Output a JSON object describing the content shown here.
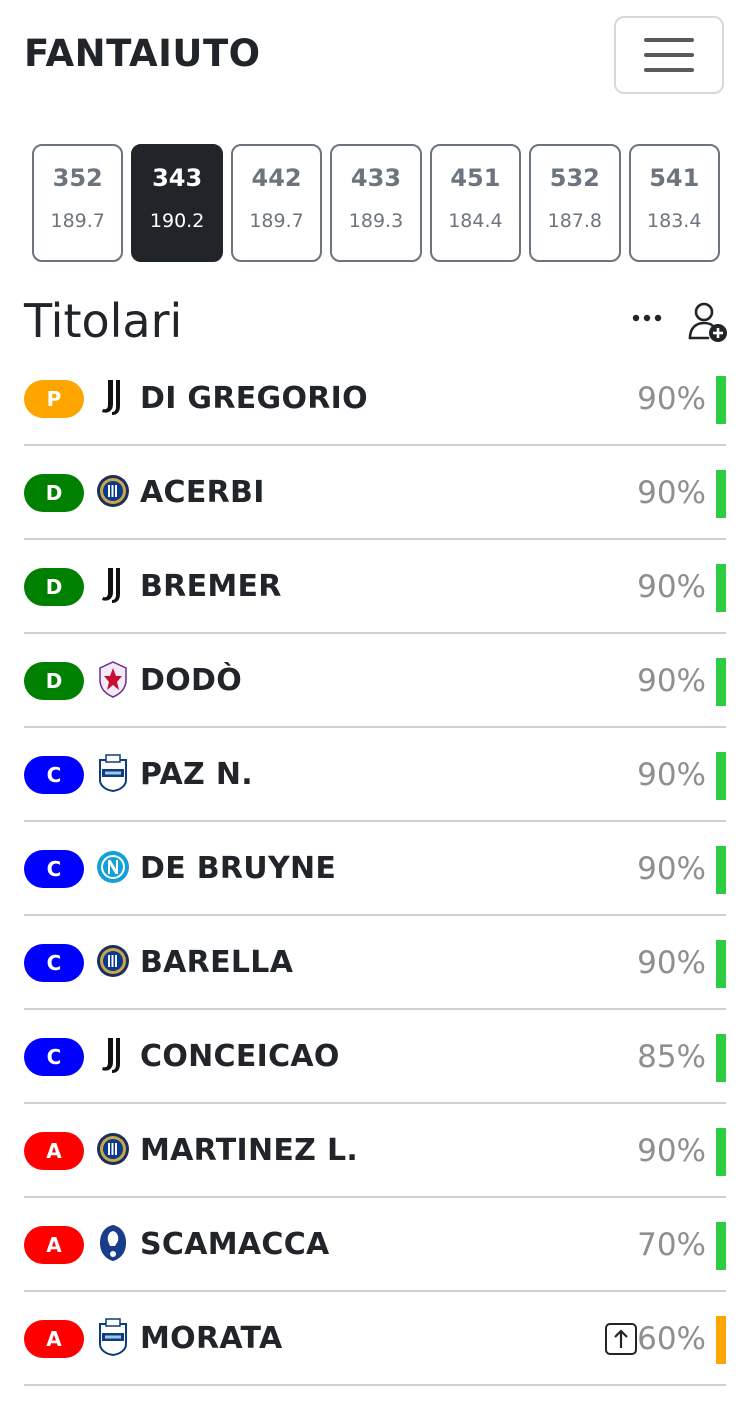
{
  "app": {
    "title": "FANTAIUTO"
  },
  "formations": [
    {
      "name": "352",
      "score": "189.7",
      "active": false
    },
    {
      "name": "343",
      "score": "190.2",
      "active": true
    },
    {
      "name": "442",
      "score": "189.7",
      "active": false
    },
    {
      "name": "433",
      "score": "189.3",
      "active": false
    },
    {
      "name": "451",
      "score": "184.4",
      "active": false
    },
    {
      "name": "532",
      "score": "187.8",
      "active": false
    },
    {
      "name": "541",
      "score": "183.4",
      "active": false
    }
  ],
  "section": {
    "title": "Titolari"
  },
  "colors": {
    "P": "#ffa500",
    "D": "#008000",
    "C": "#0000ff",
    "A": "#ff0000",
    "status_green": "#2ecc40",
    "status_orange": "#ffa500"
  },
  "players": [
    {
      "role": "P",
      "team_icon": "juventus-logo-icon",
      "name": "DI GREGORIO",
      "pct": "90%",
      "status": "status_green"
    },
    {
      "role": "D",
      "team_icon": "inter-logo-icon",
      "name": "ACERBI",
      "pct": "90%",
      "status": "status_green"
    },
    {
      "role": "D",
      "team_icon": "juventus-logo-icon",
      "name": "BREMER",
      "pct": "90%",
      "status": "status_green"
    },
    {
      "role": "D",
      "team_icon": "fiorentina-logo-icon",
      "name": "DODÒ",
      "pct": "90%",
      "status": "status_green"
    },
    {
      "role": "C",
      "team_icon": "como-logo-icon",
      "name": "PAZ N.",
      "pct": "90%",
      "status": "status_green"
    },
    {
      "role": "C",
      "team_icon": "napoli-logo-icon",
      "name": "DE BRUYNE",
      "pct": "90%",
      "status": "status_green"
    },
    {
      "role": "C",
      "team_icon": "inter-logo-icon",
      "name": "BARELLA",
      "pct": "90%",
      "status": "status_green"
    },
    {
      "role": "C",
      "team_icon": "juventus-logo-icon",
      "name": "CONCEICAO",
      "pct": "85%",
      "status": "status_green"
    },
    {
      "role": "A",
      "team_icon": "inter-logo-icon",
      "name": "MARTINEZ L.",
      "pct": "90%",
      "status": "status_green"
    },
    {
      "role": "A",
      "team_icon": "atalanta-logo-icon",
      "name": "SCAMACCA",
      "pct": "70%",
      "status": "status_green"
    },
    {
      "role": "A",
      "team_icon": "como-logo-icon",
      "name": "MORATA",
      "pct": "60%",
      "status": "status_orange",
      "extra_icon": "arrow-up-square-icon"
    }
  ]
}
